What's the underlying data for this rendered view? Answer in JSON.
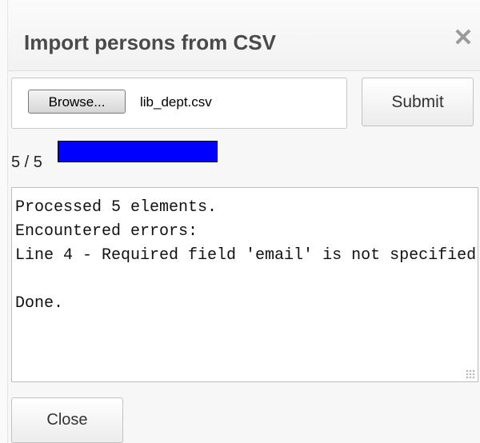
{
  "dialog": {
    "title": "Import persons from CSV",
    "close_icon": "✕",
    "close_icon_name": "close-icon"
  },
  "file_input": {
    "browse_label": "Browse...",
    "file_name": "lib_dept.csv"
  },
  "submit_label": "Submit",
  "progress": {
    "text": "5 / 5",
    "value": 1.0,
    "color": "#0000ff"
  },
  "log": {
    "text": "Processed 5 elements.\nEncountered errors:\nLine 4 - Required field 'email' is not specified\n\nDone."
  },
  "close_label": "Close"
}
